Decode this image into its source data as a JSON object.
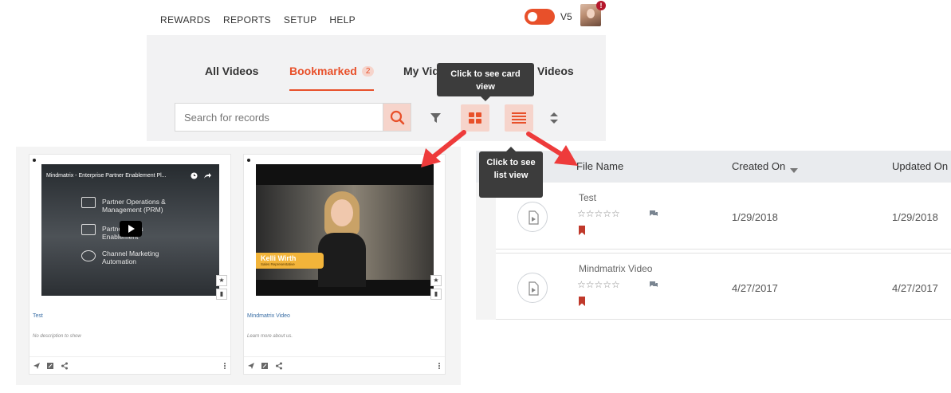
{
  "nav": {
    "menu": [
      "REWARDS",
      "REPORTS",
      "SETUP",
      "HELP"
    ],
    "version": "V5",
    "notification_badge": "!"
  },
  "tabs": {
    "all": "All Videos",
    "bookmarked": "Bookmarked",
    "bookmarked_count": "2",
    "my_partial": "My Video",
    "other_partial": "Videos"
  },
  "search": {
    "placeholder": "Search for records"
  },
  "tooltips": {
    "card": "Click to see card view",
    "list": "Click to see list view"
  },
  "cards": [
    {
      "title": "Test",
      "description": "No description to show",
      "video_title": "Mindmatrix - Enterprise Partner Enablement Pl...",
      "video_rows": [
        "Partner Operations &",
        "Management (PRM)",
        "Partner Sales",
        "Enablement",
        "Channel Marketing",
        "Automation"
      ]
    },
    {
      "title": "Mindmatrix Video",
      "description": "Learn more about us.",
      "presenter_name": "Kelli Wirth",
      "presenter_role": "Sales Representative"
    }
  ],
  "list": {
    "columns": [
      "File Name",
      "Created On",
      "Updated On"
    ],
    "rows": [
      {
        "name": "Test",
        "stars": "☆☆☆☆☆",
        "created": "1/29/2018",
        "updated": "1/29/2018"
      },
      {
        "name": "Mindmatrix Video",
        "stars": "☆☆☆☆☆",
        "created": "4/27/2017",
        "updated": "4/27/2017"
      }
    ]
  },
  "colors": {
    "accent": "#e8502a",
    "accent_light": "#f6d4cb",
    "annotation_arrow": "#ee3b3b",
    "bookmark": "#c0392b",
    "tooltip_bg": "#3c3c3c"
  },
  "icons": [
    "search-icon",
    "filter-icon",
    "card-view-icon",
    "list-view-icon",
    "sort-icon",
    "chat-icon",
    "bookmark-icon",
    "video-file-icon",
    "send-icon",
    "edit-icon",
    "share-icon",
    "more-icon"
  ]
}
